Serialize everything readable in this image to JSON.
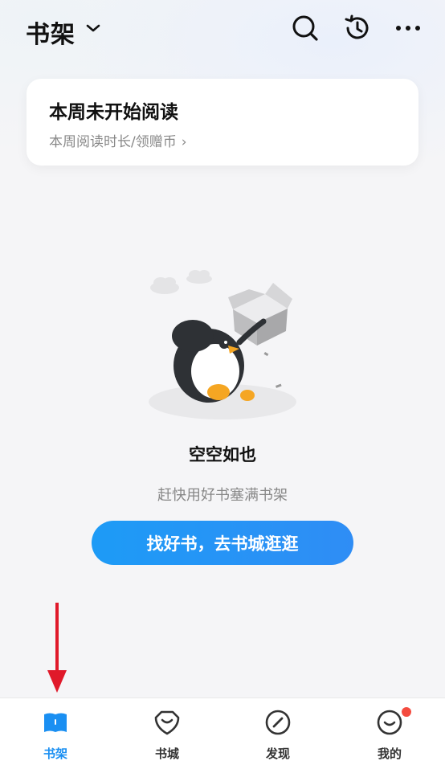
{
  "header": {
    "title": "书架",
    "icons": [
      "chevron-down-icon",
      "search-icon",
      "history-icon",
      "more-icon"
    ]
  },
  "reading_card": {
    "title": "本周未开始阅读",
    "subtitle": "本周阅读时长/领赠币",
    "chevron": "›"
  },
  "empty_state": {
    "title": "空空如也",
    "subtitle": "赶快用好书塞满书架",
    "cta_label": "找好书，去书城逛逛",
    "illustration": "penguin-with-empty-box"
  },
  "tabbar": {
    "items": [
      {
        "label": "书架",
        "icon": "bookshelf-icon",
        "active": true
      },
      {
        "label": "书城",
        "icon": "bookstore-icon",
        "active": false
      },
      {
        "label": "发现",
        "icon": "discover-icon",
        "active": false
      },
      {
        "label": "我的",
        "icon": "profile-icon",
        "active": false,
        "badge": true
      }
    ]
  },
  "colors": {
    "accent": "#1a8ff2",
    "cta_gradient_start": "#1d9bf6",
    "cta_gradient_end": "#2f8df5",
    "badge": "#f44b3f",
    "annotation_arrow": "#e0192a"
  }
}
